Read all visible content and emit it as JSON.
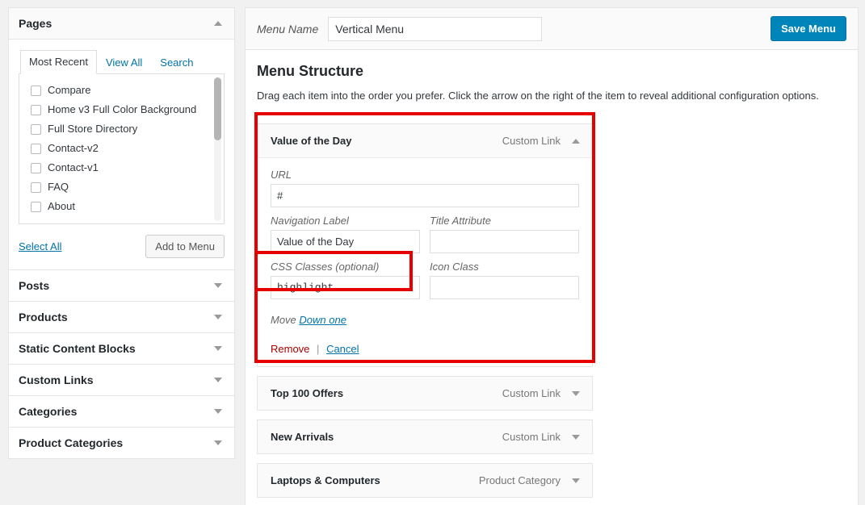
{
  "sidebar": {
    "pages_panel": {
      "title": "Pages",
      "collapse_icon": "chevron-up-icon",
      "tabs": [
        {
          "label": "Most Recent",
          "active": true
        },
        {
          "label": "View All",
          "active": false
        },
        {
          "label": "Search",
          "active": false
        }
      ],
      "items": [
        {
          "label": "Compare",
          "checked": false
        },
        {
          "label": "Home v3 Full Color Background",
          "checked": false
        },
        {
          "label": "Full Store Directory",
          "checked": false
        },
        {
          "label": "Contact-v2",
          "checked": false
        },
        {
          "label": "Contact-v1",
          "checked": false
        },
        {
          "label": "FAQ",
          "checked": false
        },
        {
          "label": "About",
          "checked": false
        }
      ],
      "select_all_label": "Select All",
      "add_to_menu_label": "Add to Menu"
    },
    "collapsed_panels": [
      {
        "title": "Posts",
        "icon": "chevron-down-icon"
      },
      {
        "title": "Products",
        "icon": "chevron-down-icon"
      },
      {
        "title": "Static Content Blocks",
        "icon": "chevron-down-icon"
      },
      {
        "title": "Custom Links",
        "icon": "chevron-down-icon"
      },
      {
        "title": "Categories",
        "icon": "chevron-down-icon"
      },
      {
        "title": "Product Categories",
        "icon": "chevron-down-icon"
      }
    ]
  },
  "header": {
    "menu_name_label": "Menu Name",
    "menu_name_value": "Vertical Menu",
    "menu_name_placeholder": "Menu Name",
    "save_menu_label": "Save Menu"
  },
  "structure": {
    "title": "Menu Structure",
    "description": "Drag each item into the order you prefer. Click the arrow on the right of the item to reveal additional configuration options."
  },
  "expanded_item": {
    "title": "Value of the Day",
    "type": "Custom Link",
    "toggle_icon": "chevron-up-icon",
    "fields": {
      "url_label": "URL",
      "url_value": "#",
      "nav_label_label": "Navigation Label",
      "nav_label_value": "Value of the Day",
      "title_attr_label": "Title Attribute",
      "title_attr_value": "",
      "css_classes_label": "CSS Classes (optional)",
      "css_classes_value": "highlight",
      "icon_class_label": "Icon Class",
      "icon_class_value": ""
    },
    "move_label": "Move",
    "move_link": "Down one",
    "remove_label": "Remove",
    "separator": "|",
    "cancel_label": "Cancel"
  },
  "collapsed_items": [
    {
      "title": "Top 100 Offers",
      "type": "Custom Link",
      "icon": "chevron-down-icon"
    },
    {
      "title": "New Arrivals",
      "type": "Custom Link",
      "icon": "chevron-down-icon"
    },
    {
      "title": "Laptops & Computers",
      "type": "Product Category",
      "icon": "chevron-down-icon"
    }
  ],
  "colors": {
    "accent": "#0085ba",
    "link": "#0073aa",
    "annotation": "#e60000",
    "remove": "#aa0000",
    "panel_bg": "#ffffff",
    "page_bg": "#f1f1f1"
  }
}
